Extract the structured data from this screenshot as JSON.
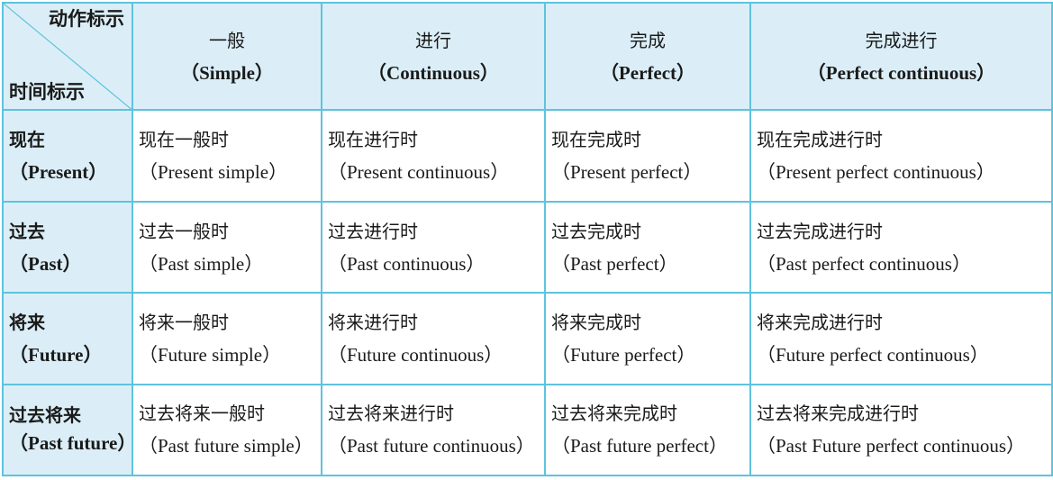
{
  "corner": {
    "top_label": "动作标示",
    "bottom_label": "时间标示"
  },
  "aspects": [
    {
      "cn": "一般",
      "en": "（Simple）"
    },
    {
      "cn": "进行",
      "en": "（Continuous）"
    },
    {
      "cn": "完成",
      "en": "（Perfect）"
    },
    {
      "cn": "完成进行",
      "en": "（Perfect continuous）"
    }
  ],
  "rows": [
    {
      "time_cn": "现在",
      "time_en": "（Present）",
      "cells": [
        {
          "cn": "现在一般时",
          "en": "（Present simple）"
        },
        {
          "cn": "现在进行时",
          "en": "（Present continuous）"
        },
        {
          "cn": "现在完成时",
          "en": "（Present perfect）"
        },
        {
          "cn": "现在完成进行时",
          "en": "（Present perfect continuous）"
        }
      ]
    },
    {
      "time_cn": "过去",
      "time_en": "（Past）",
      "cells": [
        {
          "cn": "过去一般时",
          "en": "（Past simple）"
        },
        {
          "cn": "过去进行时",
          "en": "（Past continuous）"
        },
        {
          "cn": "过去完成时",
          "en": "（Past perfect）"
        },
        {
          "cn": "过去完成进行时",
          "en": "（Past perfect continuous）"
        }
      ]
    },
    {
      "time_cn": "将来",
      "time_en": "（Future）",
      "cells": [
        {
          "cn": "将来一般时",
          "en": "（Future simple）"
        },
        {
          "cn": "将来进行时",
          "en": "（Future continuous）"
        },
        {
          "cn": "将来完成时",
          "en": "（Future perfect）"
        },
        {
          "cn": "将来完成进行时",
          "en": "（Future perfect continuous）"
        }
      ]
    },
    {
      "time_cn": "过去将来",
      "time_en": "（Past future）",
      "cells": [
        {
          "cn": "过去将来一般时",
          "en": "（Past future simple）"
        },
        {
          "cn": "过去将来进行时",
          "en": "（Past future continuous）"
        },
        {
          "cn": "过去将来完成时",
          "en": "（Past future perfect）"
        },
        {
          "cn": "过去将来完成进行时",
          "en": "（Past Future perfect continuous）"
        }
      ]
    }
  ]
}
